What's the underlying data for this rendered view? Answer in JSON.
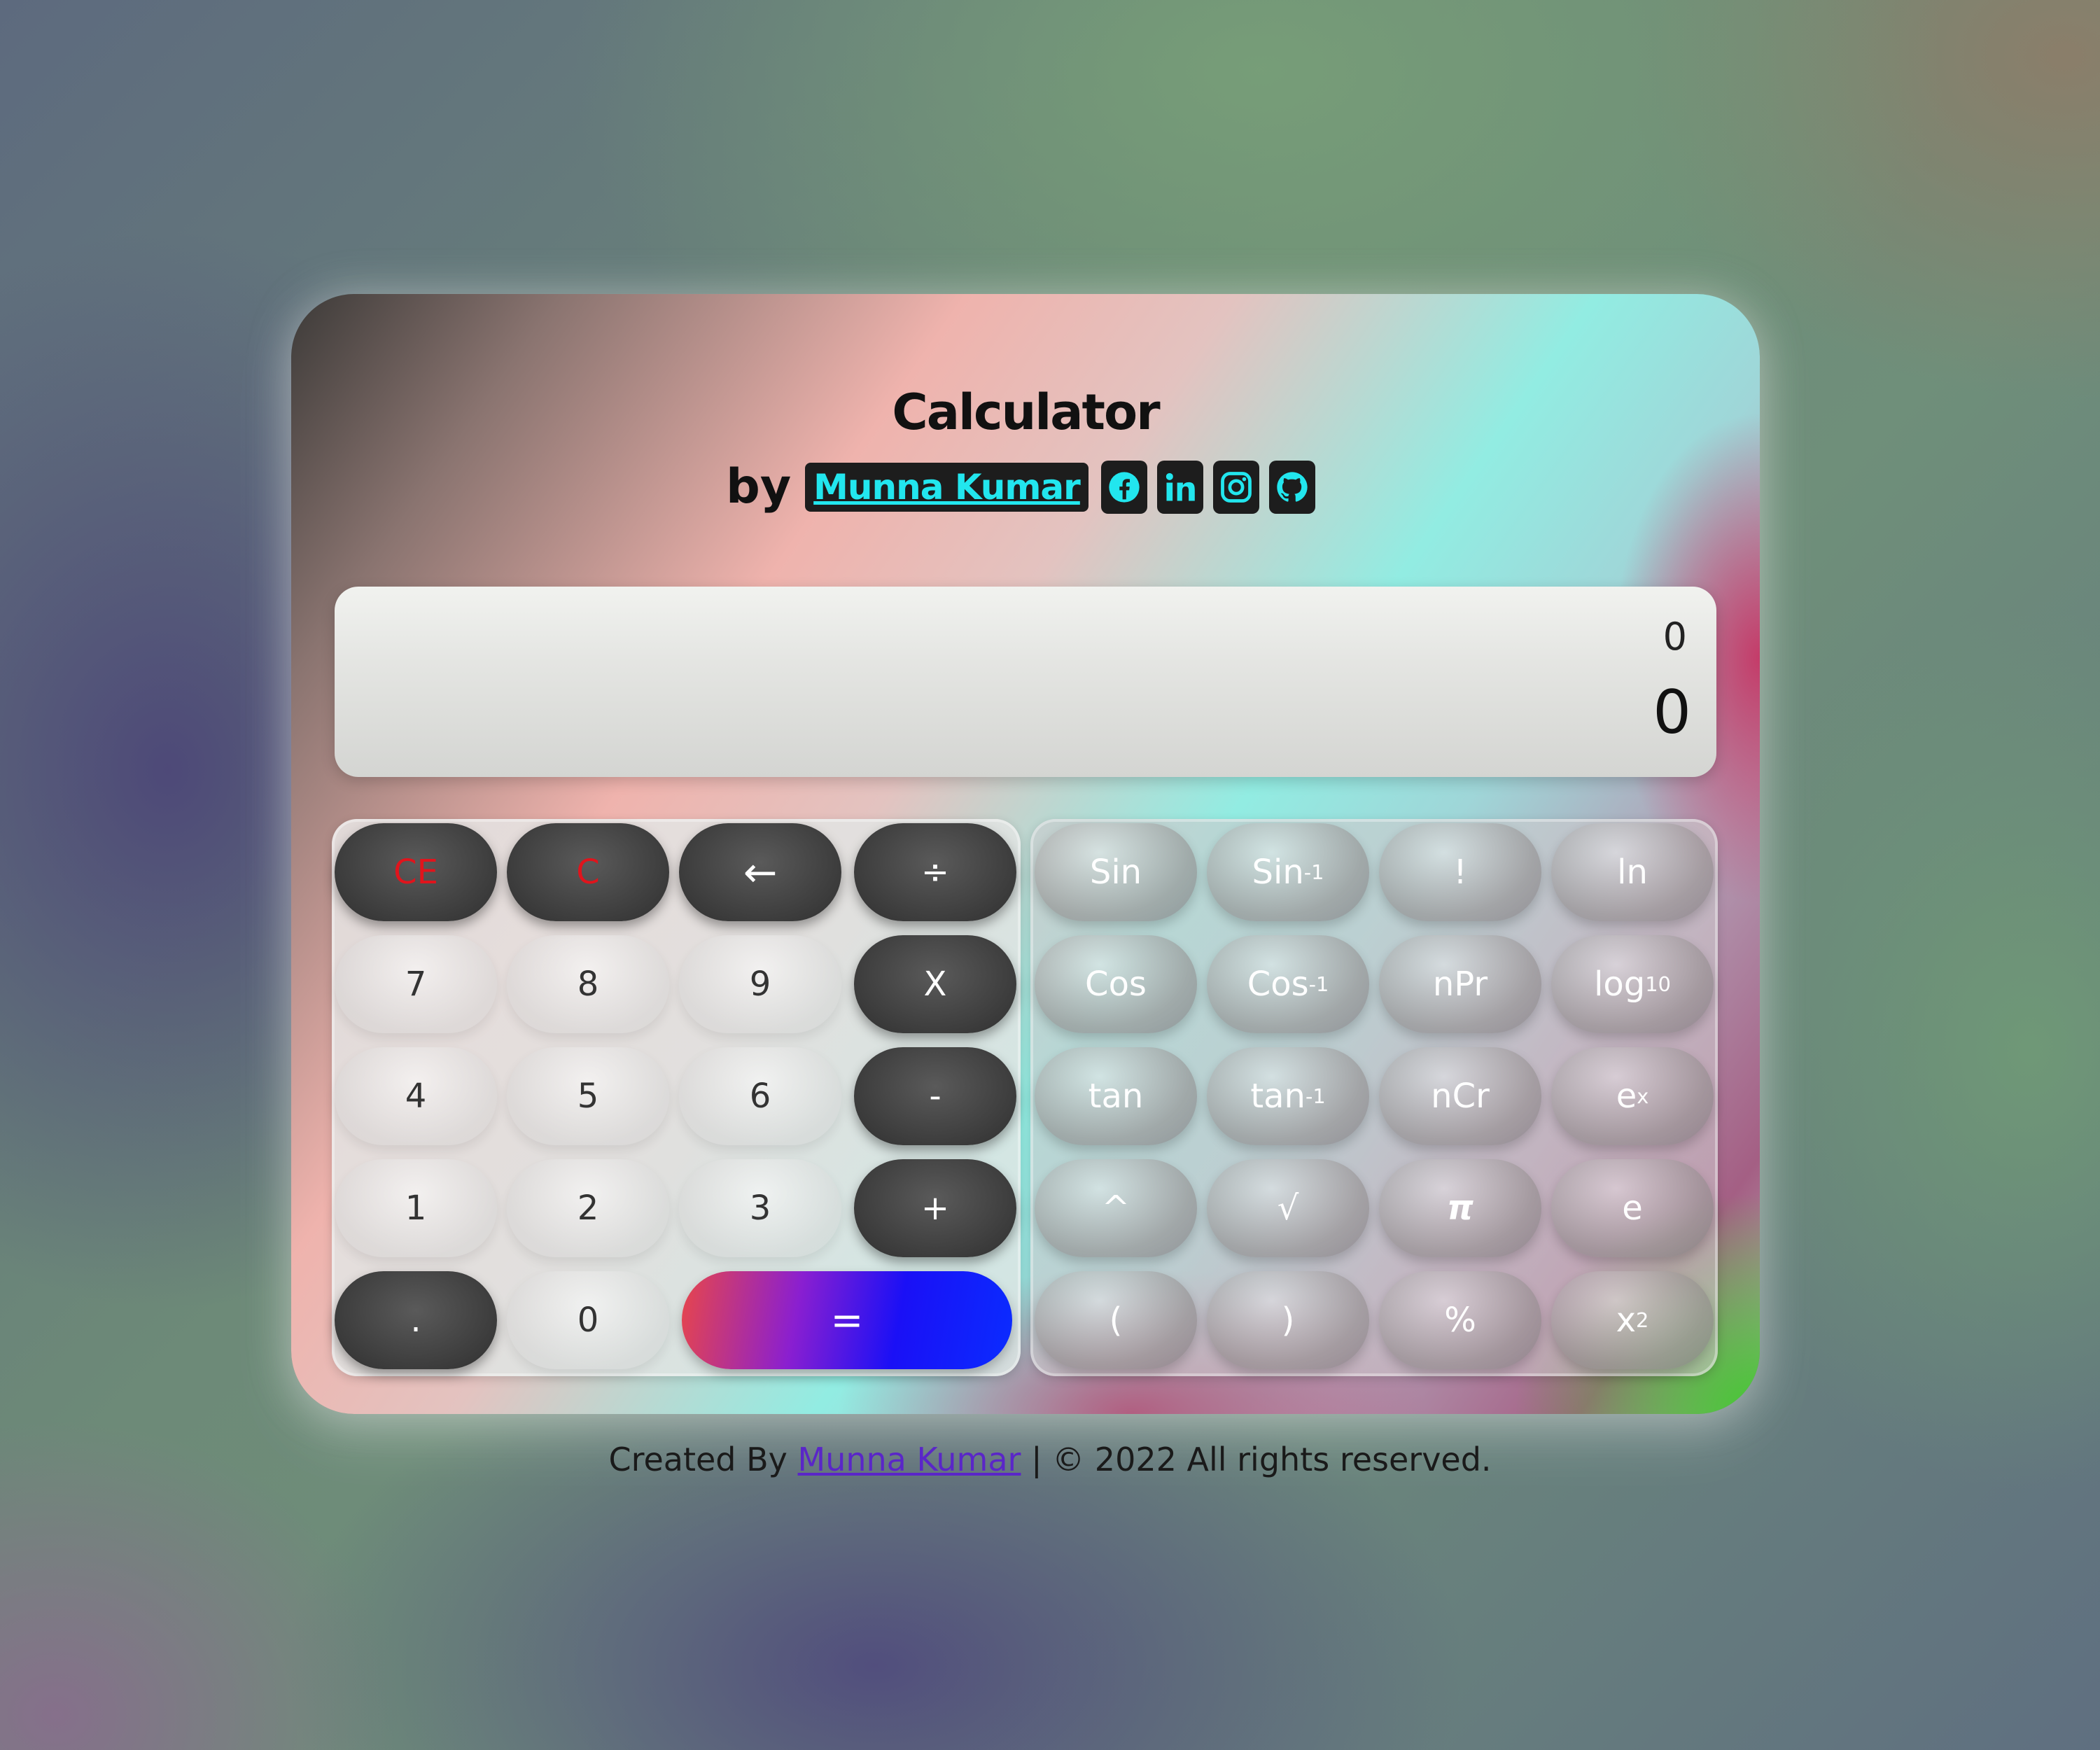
{
  "header": {
    "title": "Calculator",
    "by": "by",
    "author": "Munna Kumar"
  },
  "social": [
    "facebook-icon",
    "linkedin-icon",
    "instagram-icon",
    "github-icon"
  ],
  "display": {
    "previous": "0",
    "current": "0"
  },
  "basic_keys": {
    "ce": "CE",
    "c": "C",
    "backspace": "←",
    "divide": "÷",
    "seven": "7",
    "eight": "8",
    "nine": "9",
    "multiply": "X",
    "four": "4",
    "five": "5",
    "six": "6",
    "minus": "-",
    "one": "1",
    "two": "2",
    "three": "3",
    "plus": "+",
    "dot": ".",
    "zero": "0",
    "equals": "="
  },
  "sci_keys": {
    "sin": "Sin",
    "asin_base": "Sin",
    "asin_exp": "-1",
    "factorial": "!",
    "ln": "ln",
    "cos": "Cos",
    "acos_base": "Cos",
    "acos_exp": "-1",
    "npr": "nPr",
    "log_base": "log",
    "log_sub": "10",
    "tan": "tan",
    "atan_base": "tan",
    "atan_exp": "-1",
    "ncr": "nCr",
    "exp_base": "e",
    "exp_sup": "x",
    "power": "^",
    "sqrt": "√",
    "pi": "π",
    "e": "e",
    "lparen": "(",
    "rparen": ")",
    "percent": "%",
    "square_base": "x",
    "square_exp": "2"
  },
  "footer": {
    "prefix": "Created By",
    "author": "Munna Kumar",
    "suffix": "| © 2022 All rights reserved."
  },
  "colors": {
    "accent_cyan": "#22e6ee",
    "danger_red": "#e0141c",
    "equals_gradient_start": "#e8464a",
    "equals_gradient_end": "#0a2cff"
  }
}
